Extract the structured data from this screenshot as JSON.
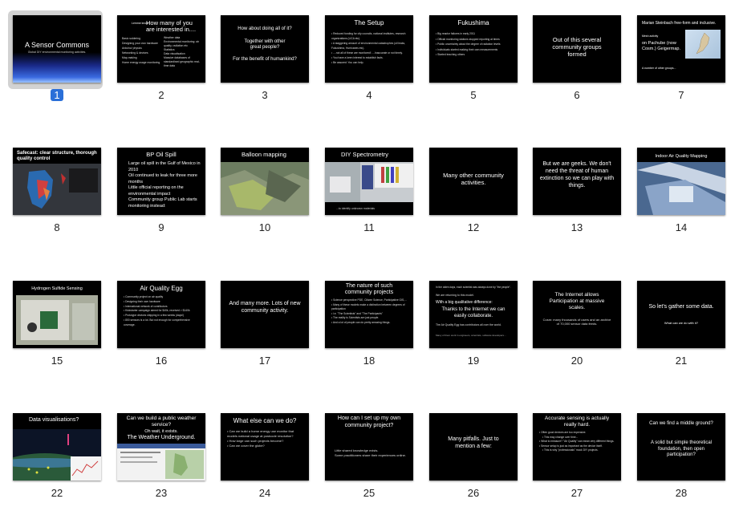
{
  "slides": [
    {
      "num": "1",
      "title": "A Sensor Commons",
      "subtitle": "Global DIY environmental monitoring activities.",
      "selected": true
    },
    {
      "num": "2",
      "title_small": "Lemme know",
      "title": "How many of you are interested in....",
      "col1": [
        "Basic soldering",
        "Designing your own hardware",
        "Arduino/ physics",
        "Networking & devices",
        "Map-making",
        "Home energy usage monitoring"
      ],
      "col2": [
        "Weather data",
        "Environmental monitoring: air quality, radiation etc",
        "Statistics",
        "Data visualisation",
        "Massive databases of standardised geographic real-time data"
      ]
    },
    {
      "num": "3",
      "lines": [
        "How about doing all of it?",
        "Together with other great people?",
        "For the benefit of humankind?"
      ]
    },
    {
      "num": "4",
      "title": "The Setup",
      "bullets": [
        "Reduced funding for city councils, national institutes, research organizations (LICA etc).",
        "A staggering amount of environmental catastrophes (oil leaks, Fukushima, Hurricanes etc).",
        "....not all of these are monitored! ....Inaccurate or not timely.",
        "You have a keen interest to establish facts.",
        "Be assured: You can help."
      ]
    },
    {
      "num": "5",
      "title": "Fukushima",
      "bullets": [
        "Big reactor failures in early 2011",
        "Official monitoring stations stopped reporting at times",
        "Public uncertainty about the degree of radiation levels",
        "Individuals started making their own measurements",
        "Started teaching others"
      ]
    },
    {
      "num": "6",
      "lines": [
        "Out of this several community groups formed"
      ]
    },
    {
      "num": "7",
      "lines": [
        "Marian Steinbach free-form and inclusive.",
        "Mesh activity",
        "on Pachube (now Cosm.) Geigermap.",
        "A number of other groups..."
      ]
    },
    {
      "num": "8",
      "title": "Safecast: clear structure, thorough quality control"
    },
    {
      "num": "9",
      "title": "BP Oil Spill",
      "lines": [
        "Large oil spill in the Gulf of Mexico in 2010",
        "Oil continued to leak for three more months",
        "Little official reporting on the environmental impact",
        "Community group Public Lab starts monitoring instead:"
      ]
    },
    {
      "num": "10",
      "title": "Balloon mapping"
    },
    {
      "num": "11",
      "title": "DIY Spectrometry",
      "caption": "...to identify unknown materials"
    },
    {
      "num": "12",
      "lines": [
        "Many other community activities."
      ]
    },
    {
      "num": "13",
      "lines": [
        "But we are geeks. We don't need the threat of human extinction so we can play with things."
      ]
    },
    {
      "num": "14",
      "title": "Indoor Air Quality Mapping"
    },
    {
      "num": "15",
      "title": "Hydrogen Sulfide Sensing"
    },
    {
      "num": "16",
      "title": "Air Quality Egg",
      "bullets": [
        "Community project on air quality",
        "Designing their own hardware",
        "International network of contributors",
        "Kickstarter campaign aimed for $40k, received > $140k",
        "Prototype devices shipping in a few weeks (days!)",
        "800 sensors is a lot. But not enough for comprehensive coverage."
      ]
    },
    {
      "num": "17",
      "lines": [
        "And many more. Lots of new community activity."
      ]
    },
    {
      "num": "18",
      "title": "The nature of such community projects",
      "bullets": [
        "Science perspective PDE, Citizen Science, Participative GIS,...",
        "Many of these models make a distinction between degrees of participation",
        "i.e. \"The Scientists\" and \"The Participants\"",
        "The reality is Scientists are just people.",
        "And a lot of people can do pretty amazing things."
      ]
    },
    {
      "num": "19",
      "lines": [
        "In the olden days, each scientist was always done by \"the people\".",
        "We are returning to this model.",
        "With a big qualitative difference:",
        "Thanks to the Internet we can easily collaborate.",
        "The Air Quality Egg has contributors all over the world.",
        "Many of them work in engineers, scientists, software developers..."
      ]
    },
    {
      "num": "20",
      "lines": [
        "The Internet allows Participation at massive scales.",
        "Cosm: many thousands of users and an archive of 70,000 sensor data feeds."
      ]
    },
    {
      "num": "21",
      "lines": [
        "So let's gather some data.",
        "What can we do with it?"
      ]
    },
    {
      "num": "22",
      "title": "Data visualisations?"
    },
    {
      "num": "23",
      "lines": [
        "Can we build a public weather service?",
        "Oh wait, it exists.",
        "The Weather Underground."
      ]
    },
    {
      "num": "24",
      "title": "What else can we do?",
      "bullets": [
        "Can we build a home energy use monitor that models national usage at postcode resolution?",
        "How large can such projects become?",
        "Can we cover the globe?"
      ]
    },
    {
      "num": "25",
      "title": "How can I set up my own community project?",
      "lines": [
        "Little shared knowledge exists.",
        "Some practitioners share their experiences online."
      ]
    },
    {
      "num": "26",
      "lines": [
        "Many pitfalls. Just to mention a few:"
      ]
    },
    {
      "num": "27",
      "title": "Accurate sensing is actually really hard.",
      "bullets": [
        "Often good devices are too expensive.",
        "This may change over time...",
        "What to measure? \"Air Quality\" can mean very different things.",
        "Sensor setup is just as important as the device itself.",
        "This is why \"professionals\" mock DIY projects."
      ]
    },
    {
      "num": "28",
      "lines": [
        "Can we find a middle ground?",
        "A solid but simple theoretical foundation, then open participation?"
      ]
    }
  ],
  "colors": {
    "selection": "#2a6fd8",
    "slide_bg": "#000000",
    "thumb_frame": "#d2d2d2"
  }
}
